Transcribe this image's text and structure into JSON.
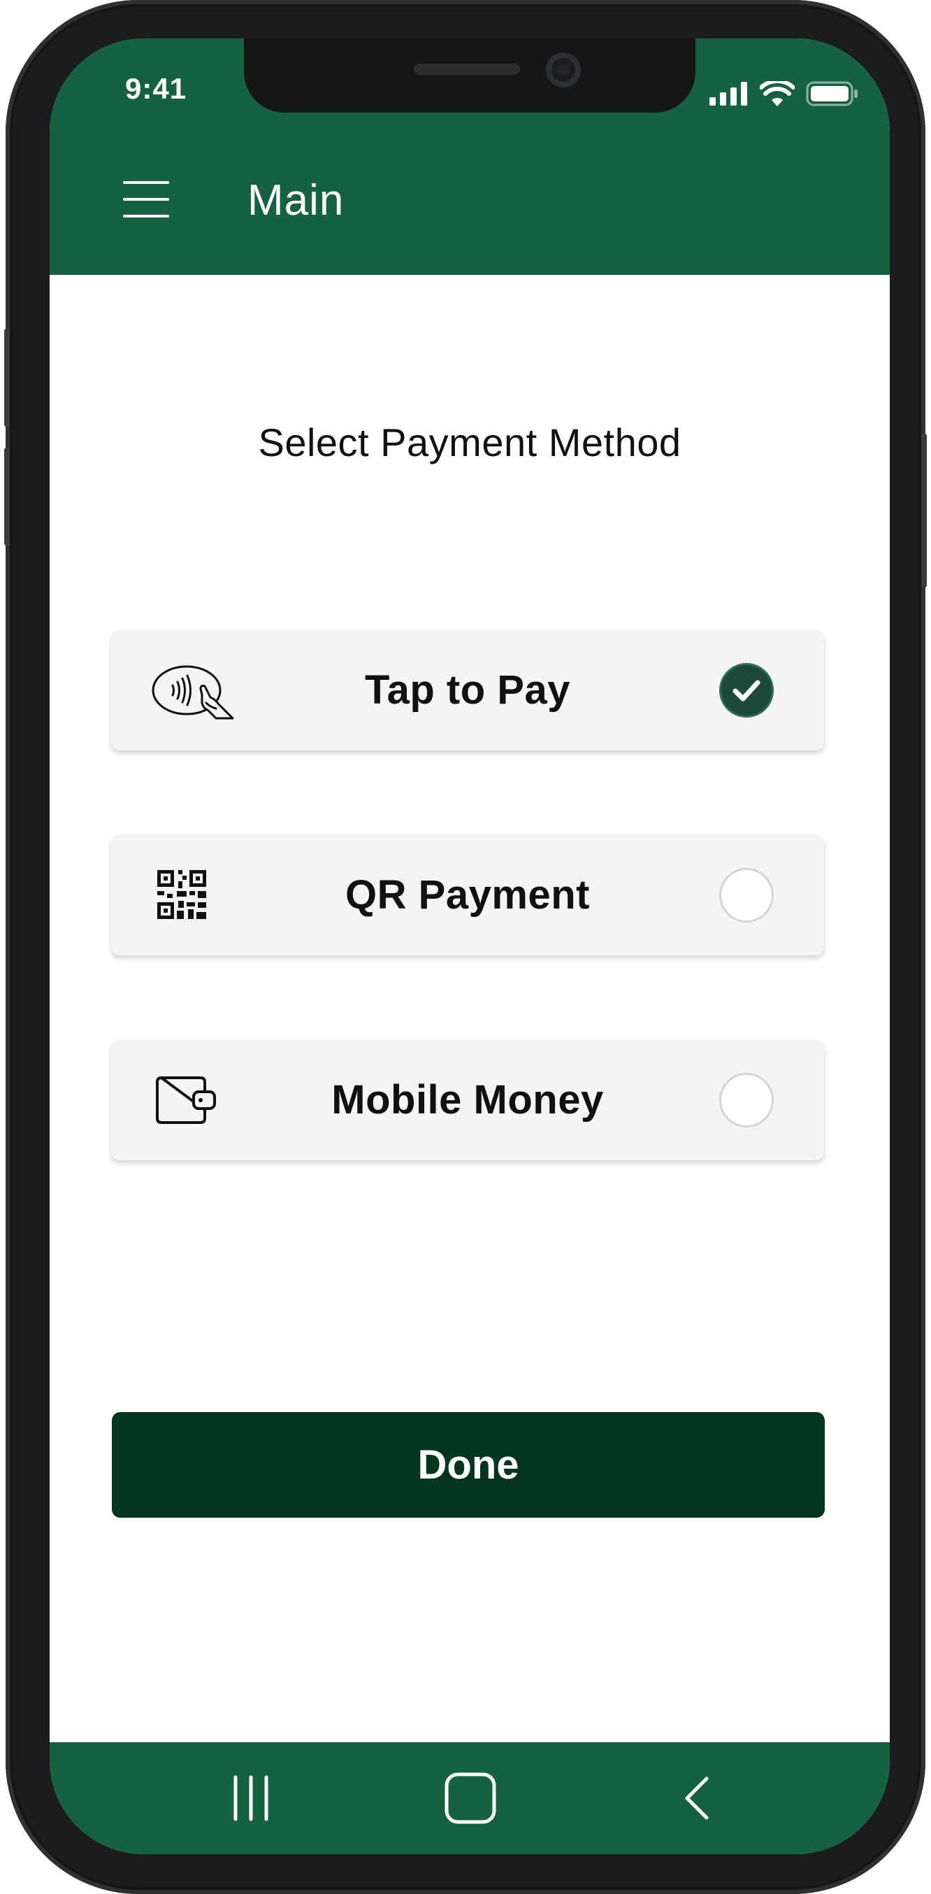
{
  "status_bar": {
    "time": "9:41"
  },
  "appbar": {
    "title": "Main"
  },
  "content": {
    "title": "Select Payment Method"
  },
  "options": [
    {
      "label": "Tap to Pay",
      "icon": "contactless-tap-icon",
      "selected": true
    },
    {
      "label": "QR Payment",
      "icon": "qr-code-icon",
      "selected": false
    },
    {
      "label": "Mobile Money",
      "icon": "wallet-icon",
      "selected": false
    }
  ],
  "done_label": "Done",
  "colors": {
    "brand_green": "#156242",
    "done_button": "#043520",
    "selected_radio": "#1b4a3c"
  }
}
